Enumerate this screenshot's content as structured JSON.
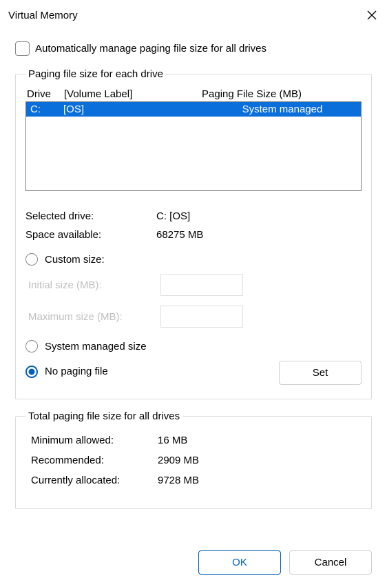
{
  "window": {
    "title": "Virtual Memory"
  },
  "autoManage": {
    "label": "Automatically manage paging file size for all drives",
    "checked": false
  },
  "driveGroup": {
    "legend": "Paging file size for each drive",
    "headers": {
      "drive": "Drive",
      "volume": "[Volume Label]",
      "pfsize": "Paging File Size (MB)"
    },
    "rows": [
      {
        "drive": "C:",
        "volume": "[OS]",
        "pfsize": "System managed",
        "selected": true
      }
    ],
    "selectedDrive": {
      "label": "Selected drive:",
      "value": "C:  [OS]"
    },
    "spaceAvailable": {
      "label": "Space available:",
      "value": "68275 MB"
    },
    "options": {
      "custom": {
        "label": "Custom size:",
        "initialLabel": "Initial size (MB):",
        "maxLabel": "Maximum size (MB):",
        "initialValue": "",
        "maxValue": ""
      },
      "system": {
        "label": "System managed size"
      },
      "none": {
        "label": "No paging file"
      },
      "selected": "none"
    },
    "setButton": "Set"
  },
  "totals": {
    "legend": "Total paging file size for all drives",
    "minAllowed": {
      "label": "Minimum allowed:",
      "value": "16 MB"
    },
    "recommended": {
      "label": "Recommended:",
      "value": "2909 MB"
    },
    "allocated": {
      "label": "Currently allocated:",
      "value": "9728 MB"
    }
  },
  "buttons": {
    "ok": "OK",
    "cancel": "Cancel"
  }
}
